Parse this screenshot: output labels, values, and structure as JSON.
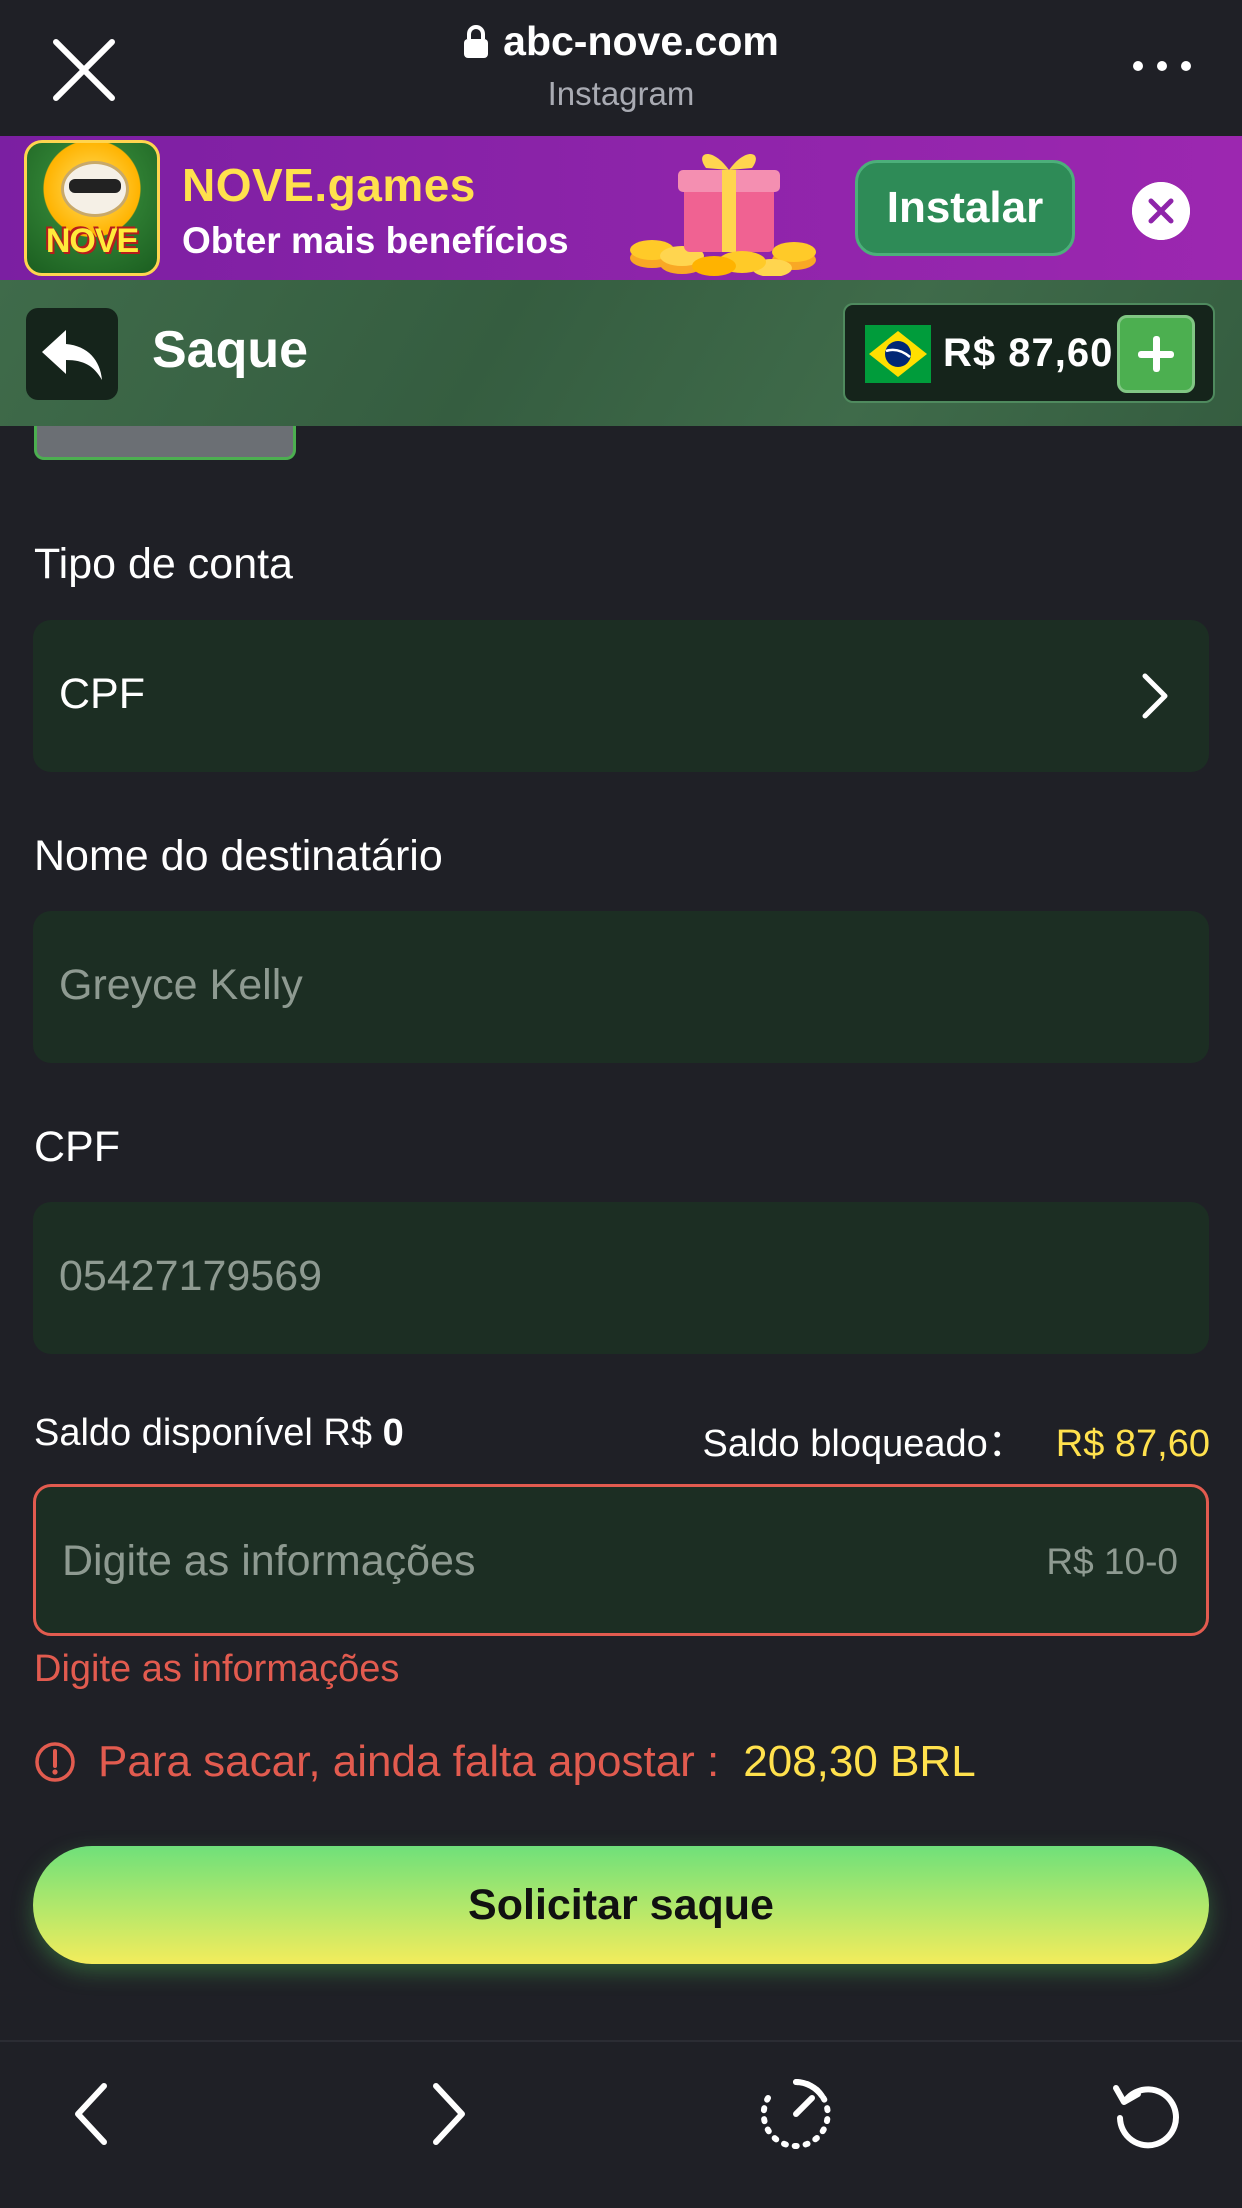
{
  "browser": {
    "domain": "abc-nove.com",
    "source_app": "Instagram"
  },
  "promo": {
    "logo_text": "NOVE",
    "title": "NOVE.games",
    "subtitle": "Obter mais benefícios",
    "install_label": "Instalar"
  },
  "header": {
    "title": "Saque",
    "balance": "R$ 87,60"
  },
  "form": {
    "account_type": {
      "label": "Tipo de conta",
      "value": "CPF"
    },
    "recipient_name": {
      "label": "Nome do destinatário",
      "value": "Greyce Kelly"
    },
    "cpf": {
      "label": "CPF",
      "value": "05427179569"
    },
    "available_balance": {
      "label": "Saldo disponível R$",
      "value": "0"
    },
    "blocked_balance": {
      "label": "Saldo bloqueado：",
      "value": "R$ 87,60"
    },
    "amount": {
      "placeholder": "Digite as informações",
      "range_hint": "R$ 10-0",
      "error": "Digite as informações"
    },
    "wager_warning": {
      "text": "Para sacar, ainda falta apostar :",
      "amount": "208,30 BRL"
    },
    "submit_label": "Solicitar saque"
  },
  "colors": {
    "accent_green": "#4caf50",
    "error_red": "#e25b4f",
    "highlight_yellow": "#ffe14d",
    "field_bg": "#1c2e23"
  },
  "icons": {
    "close": "close-icon",
    "lock": "lock-icon",
    "more": "more-dots-icon",
    "back": "back-arrow-icon",
    "flag": "brazil-flag-icon",
    "plus": "plus-icon",
    "chevron": "chevron-right-icon",
    "warning": "warning-circle-icon",
    "nav_back": "chevron-left-icon",
    "nav_forward": "chevron-right-icon",
    "speed": "speedometer-icon",
    "reload": "reload-icon"
  }
}
